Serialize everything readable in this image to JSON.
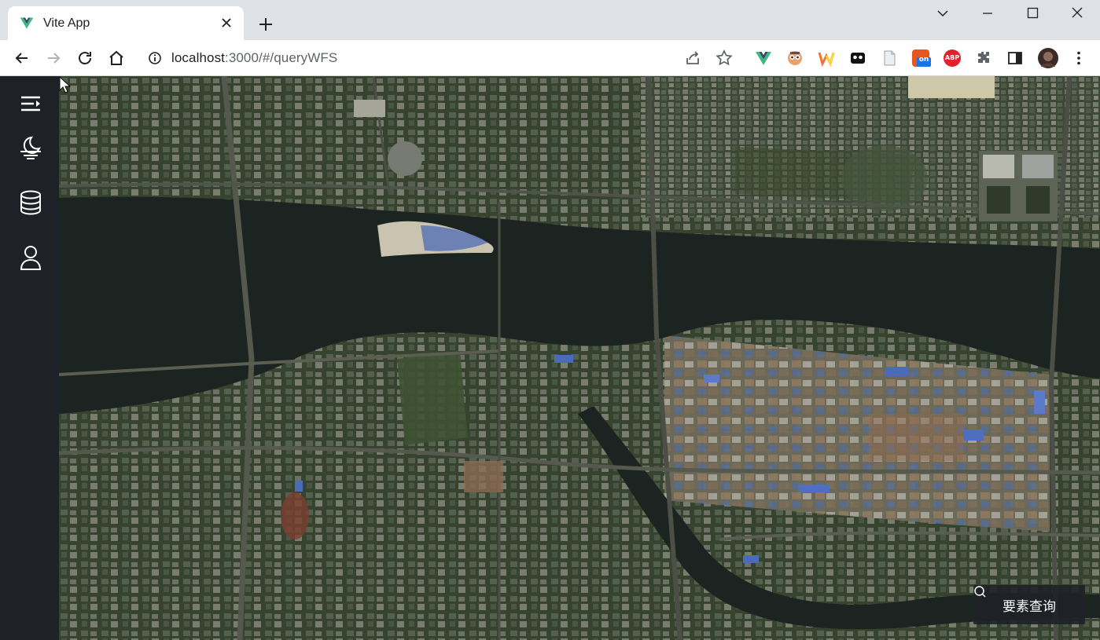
{
  "browser": {
    "tab_title": "Vite App",
    "url_host": "localhost",
    "url_path": ":3000/#/queryWFS",
    "tab_favicon": "vue-icon",
    "extensions": [
      {
        "name": "vue-devtools-extension",
        "label": ""
      },
      {
        "name": "owl-extension",
        "label": ""
      },
      {
        "name": "w-extension",
        "label": ""
      },
      {
        "name": "mask-extension",
        "label": ""
      },
      {
        "name": "document-extension",
        "label": ""
      },
      {
        "name": "on-extension",
        "label": "on"
      },
      {
        "name": "adblock-plus-extension",
        "label": "ABP"
      }
    ],
    "window_controls": [
      "minimize",
      "maximize",
      "close"
    ]
  },
  "sidebar": {
    "items": [
      {
        "name": "menu-toggle",
        "icon": "indent-icon"
      },
      {
        "name": "weather",
        "icon": "sunset-icon"
      },
      {
        "name": "database",
        "icon": "database-icon"
      },
      {
        "name": "user",
        "icon": "user-icon"
      }
    ],
    "background": "#1e2227"
  },
  "map": {
    "type": "satellite imagery",
    "query_button_label": "要素查询",
    "query_button_icon": "search-icon"
  },
  "colors": {
    "tab_strip": "#dee1e6",
    "river": "#1b2420",
    "vegetation": "#2f3f2a"
  }
}
